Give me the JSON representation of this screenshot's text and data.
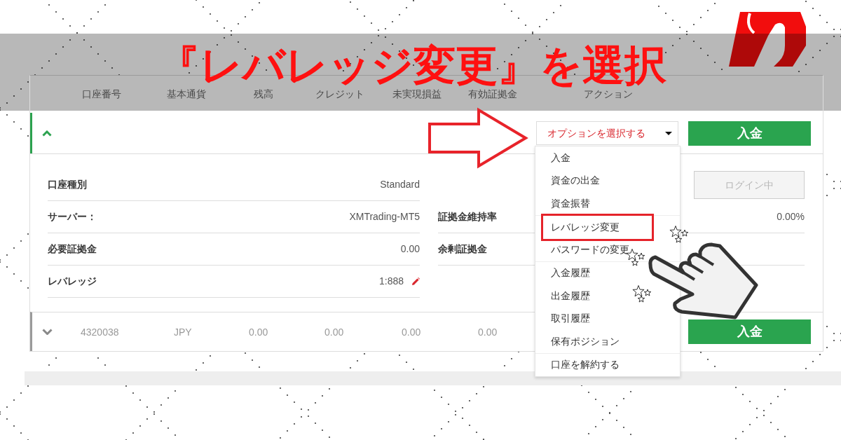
{
  "banner": {
    "title": "『レバレッジ変更』を選択"
  },
  "table": {
    "columns": [
      "口座番号",
      "基本通貨",
      "残高",
      "クレジット",
      "未実現損益",
      "有効証拠金",
      "アクション"
    ]
  },
  "accounts": [
    {
      "expanded": true,
      "select": {
        "label": "オプションを選択する",
        "open": true,
        "groups": [
          {
            "items": [
              {
                "label": "入金",
                "highlighted": false
              },
              {
                "label": "資金の出金",
                "highlighted": false
              },
              {
                "label": "資金振替",
                "highlighted": false
              }
            ]
          },
          {
            "items": [
              {
                "label": "レバレッジ変更",
                "highlighted": true
              },
              {
                "label": "パスワードの変更",
                "highlighted": false
              }
            ]
          },
          {
            "items": [
              {
                "label": "入金履歴",
                "highlighted": false
              },
              {
                "label": "出金履歴",
                "highlighted": false
              },
              {
                "label": "取引履歴",
                "highlighted": false
              },
              {
                "label": "保有ポジション",
                "highlighted": false
              }
            ]
          },
          {
            "items": [
              {
                "label": "口座を解約する",
                "highlighted": false
              }
            ]
          }
        ]
      },
      "deposit_button": "入金",
      "details": {
        "left": [
          {
            "label": "口座種別",
            "value": "Standard",
            "editable": false
          },
          {
            "label": "サーバー：",
            "value": "XMTrading-MT5",
            "editable": false
          },
          {
            "label": "必要証拠金",
            "value": "0.00",
            "editable": false
          },
          {
            "label": "レバレッジ",
            "value": "1:888",
            "editable": true
          }
        ],
        "right": [
          {
            "kind": "button",
            "label": "ログイン中",
            "disabled": true
          },
          {
            "kind": "pair",
            "label": "証拠金維持率",
            "value": "0.00%"
          },
          {
            "kind": "pair",
            "label": "余剰証拠金"
          }
        ]
      }
    },
    {
      "expanded": false,
      "cells": [
        "4320038",
        "JPY",
        "0.00",
        "0.00",
        "0.00",
        "0.00"
      ],
      "deposit_button": "入金"
    }
  ]
}
